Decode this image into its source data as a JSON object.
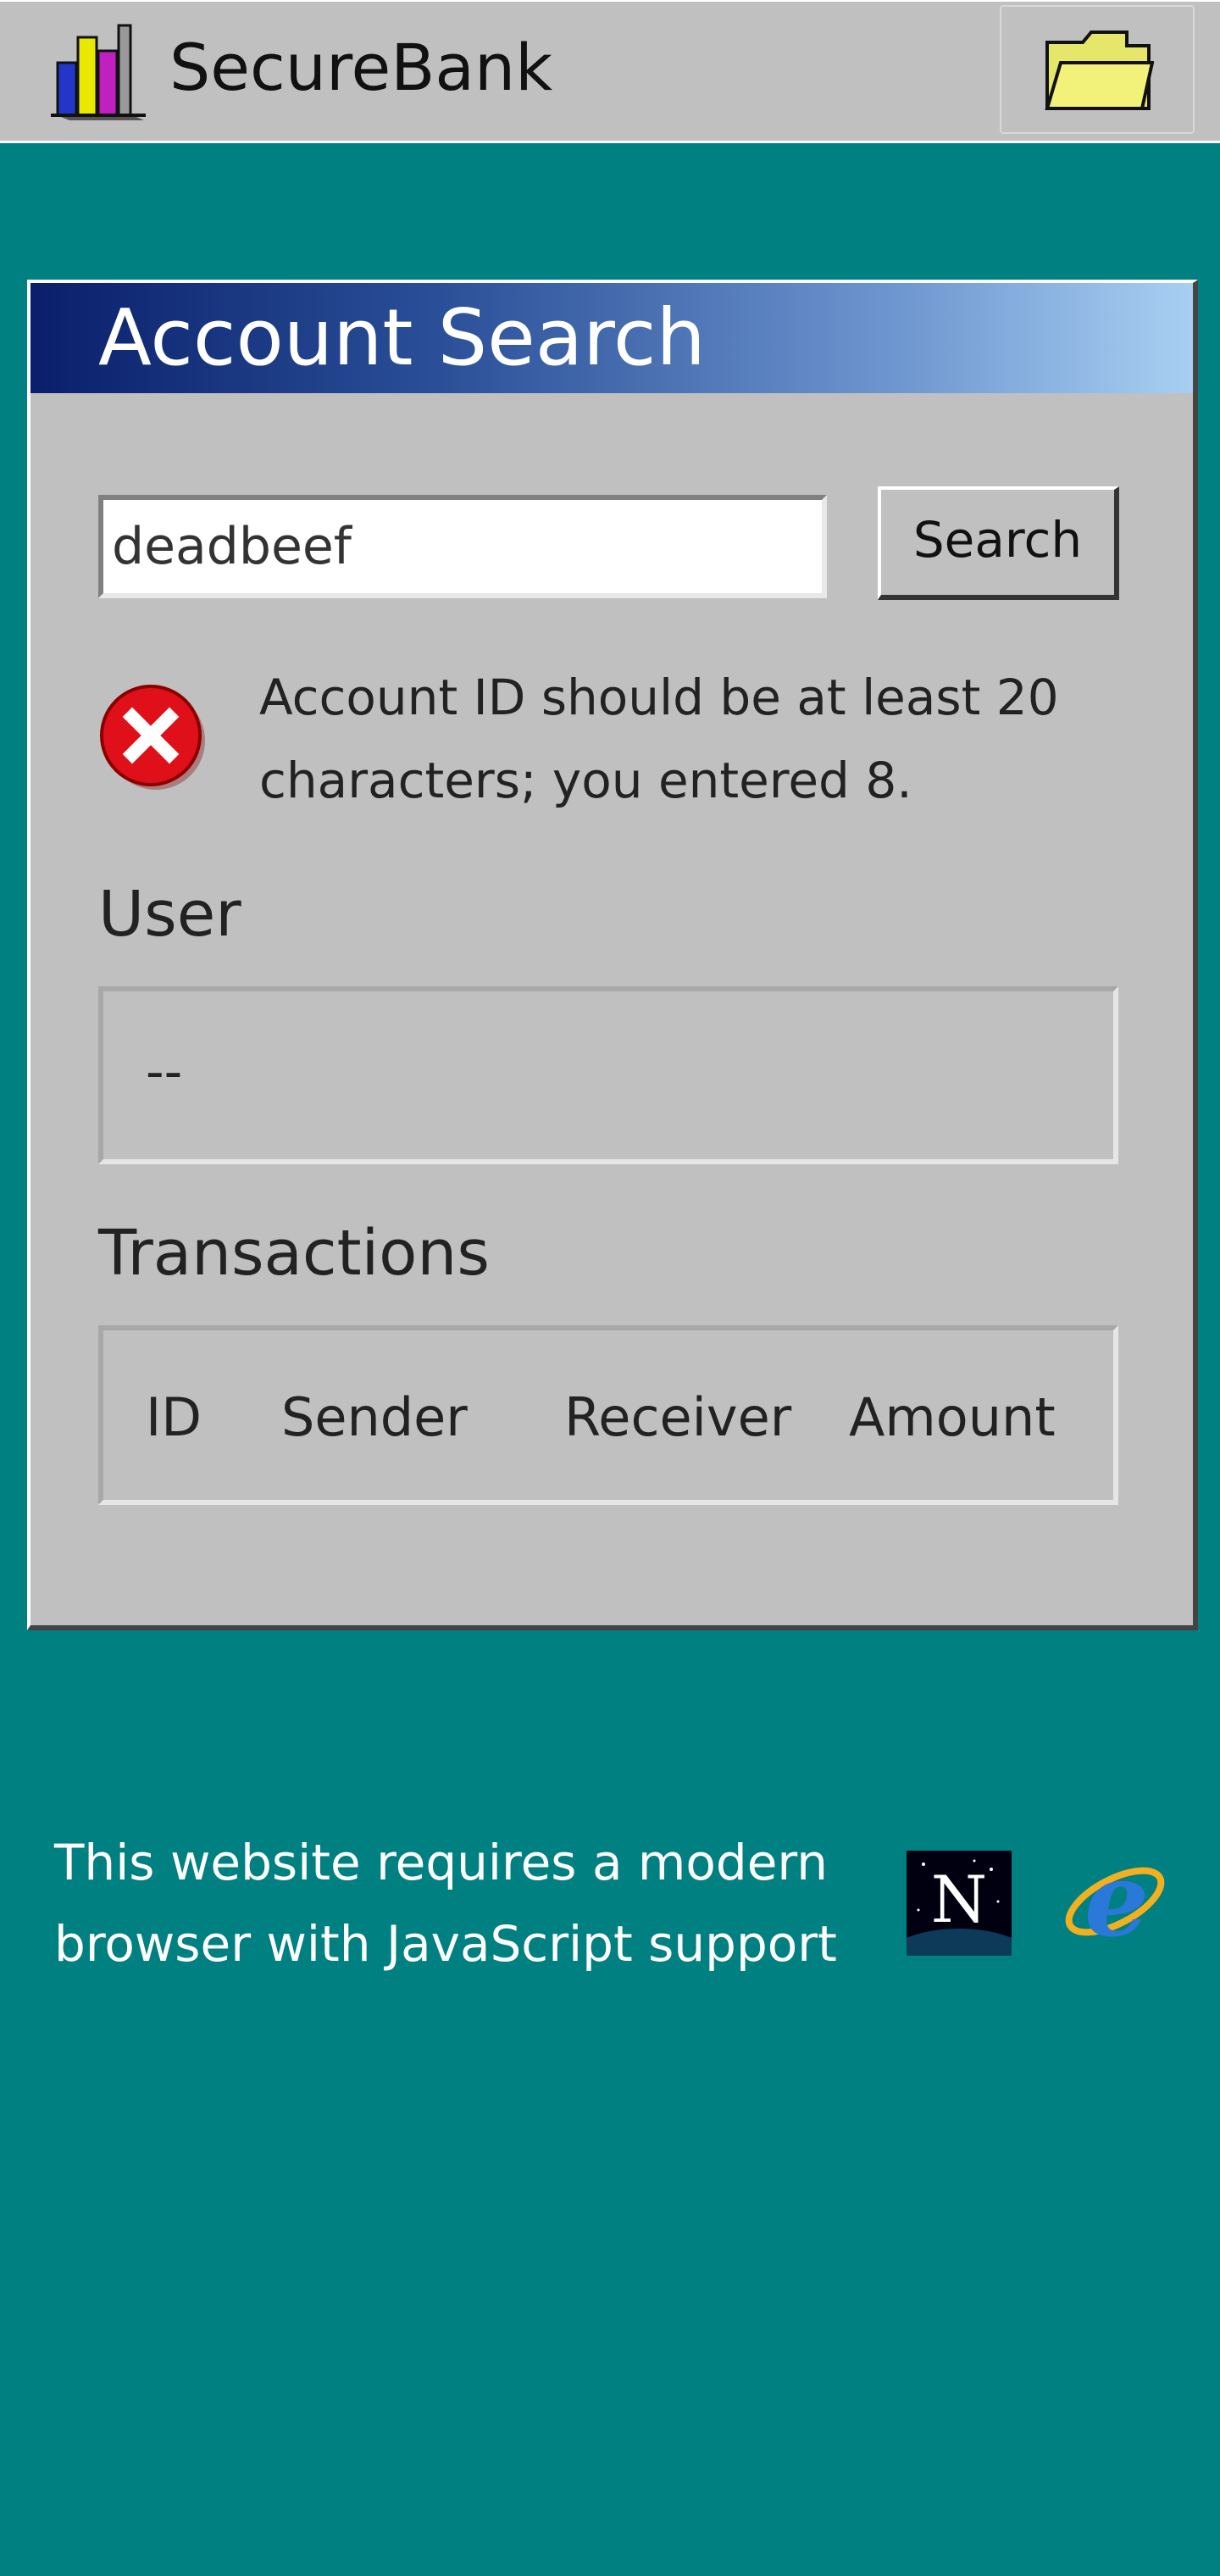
{
  "app": {
    "brand": "SecureBank",
    "logo_icon": "bar-chart-logo-icon",
    "folder_icon": "folder-icon"
  },
  "window": {
    "title": "Account Search"
  },
  "search": {
    "value": "deadbeef",
    "placeholder": "",
    "button_label": "Search"
  },
  "error": {
    "icon": "error-x-icon",
    "message": "Account ID should be at least 20 characters; you entered 8."
  },
  "user": {
    "label": "User",
    "value": "--"
  },
  "transactions": {
    "label": "Transactions",
    "columns": [
      "ID",
      "Sender",
      "Receiver",
      "Amount"
    ],
    "rows": []
  },
  "footer": {
    "message": "This website requires a modern browser with JavaScript support",
    "netscape_icon": "netscape-icon",
    "ie_icon": "internet-explorer-icon"
  },
  "colors": {
    "desktop": "#008080",
    "chrome": "#c0c0c0",
    "title_gradient_start": "#0a1f6b",
    "title_gradient_end": "#a8cff2",
    "error_red": "#e0101a"
  }
}
